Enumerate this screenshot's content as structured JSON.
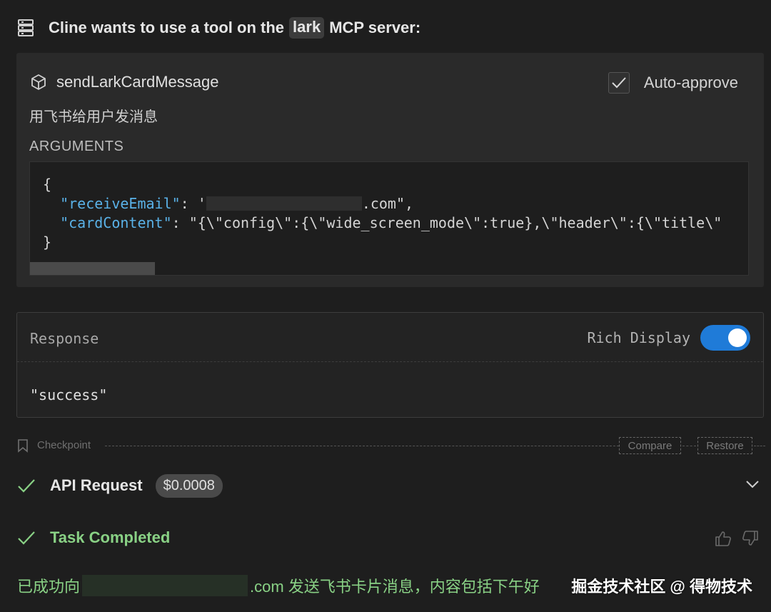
{
  "header": {
    "prefix": "Cline wants to use a tool on the",
    "server": "lark",
    "suffix": "MCP server:",
    "icon": "server-icon"
  },
  "tool": {
    "name": "sendLarkCardMessage",
    "icon": "cube-icon",
    "description": "用飞书给用户发消息",
    "auto_approve_label": "Auto-approve",
    "auto_approve_checked": true,
    "arguments_label": "ARGUMENTS",
    "arguments": {
      "open_brace": "{",
      "email_key": "\"receiveEmail\"",
      "email_value_start": "'",
      "email_value_end": ".com\",",
      "card_key": "\"cardContent\"",
      "card_value": "\"{\\\"config\\\":{\\\"wide_screen_mode\\\":true},\\\"header\\\":{\\\"title\\\"",
      "close_brace": "}"
    }
  },
  "response": {
    "label": "Response",
    "rich_display_label": "Rich Display",
    "rich_display_on": true,
    "value": "\"success\""
  },
  "checkpoint": {
    "label": "Checkpoint",
    "compare_label": "Compare",
    "restore_label": "Restore",
    "icon": "bookmark-icon"
  },
  "api_request": {
    "label": "API Request",
    "cost": "$0.0008",
    "icon": "check-icon"
  },
  "task": {
    "label": "Task Completed",
    "icon": "check-icon"
  },
  "result": {
    "prefix": "已成功向",
    "suffix": ".com 发送飞书卡片消息，内容包括下午好"
  },
  "watermark": "掘金技术社区 @ 得物技术",
  "colors": {
    "background": "#1e1e1e",
    "card": "#2a2a2a",
    "accent": "#1f7bd8",
    "success": "#89d185",
    "json_key": "#5ab2e8"
  }
}
